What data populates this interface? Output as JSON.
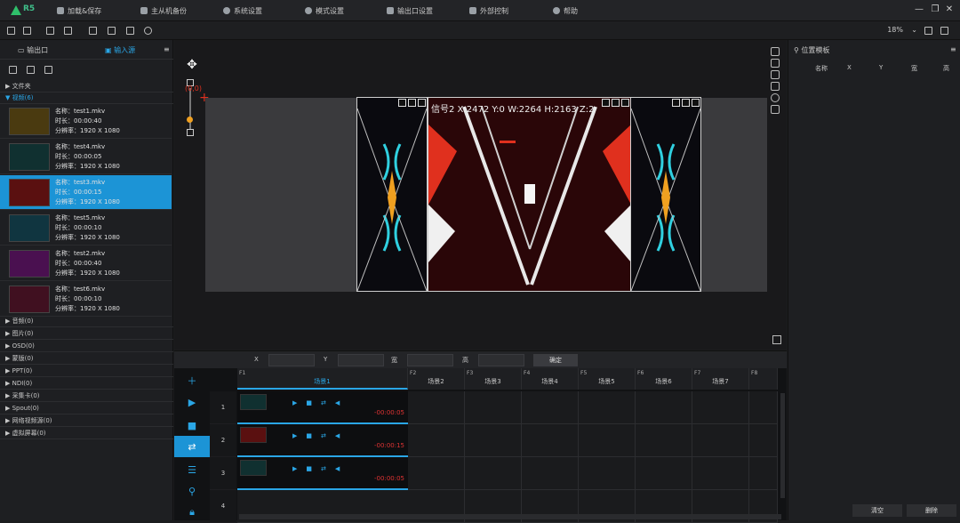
{
  "app": {
    "logo_text": "R5"
  },
  "menu": [
    {
      "label": "加载&保存",
      "icon": "save-icon"
    },
    {
      "label": "主从机备份",
      "icon": "backup-icon"
    },
    {
      "label": "系统设置",
      "icon": "gear-icon"
    },
    {
      "label": "模式设置",
      "icon": "mode-icon"
    },
    {
      "label": "输出口设置",
      "icon": "output-icon"
    },
    {
      "label": "外部控制",
      "icon": "control-icon"
    },
    {
      "label": "帮助",
      "icon": "help-icon"
    }
  ],
  "toolbar": {
    "zoom": "18%"
  },
  "left_panel": {
    "tabs": [
      {
        "label": "输出口",
        "active": false
      },
      {
        "label": "输入源",
        "active": true
      }
    ],
    "categories_top": [
      {
        "label": "文件夹"
      },
      {
        "label": "视频(6)"
      }
    ],
    "media": [
      {
        "name": "名称：test1.mkv",
        "duration": "时长：00:00:40",
        "resolution": "分辨率：1920 X 1080",
        "selected": false,
        "thumb": "#4a3a10"
      },
      {
        "name": "名称：test4.mkv",
        "duration": "时长：00:00:05",
        "resolution": "分辨率：1920 X 1080",
        "selected": false,
        "thumb": "#103030"
      },
      {
        "name": "名称：test3.mkv",
        "duration": "时长：00:00:15",
        "resolution": "分辨率：1920 X 1080",
        "selected": true,
        "thumb": "#5a1010"
      },
      {
        "name": "名称：test5.mkv",
        "duration": "时长：00:00:10",
        "resolution": "分辨率：1920 X 1080",
        "selected": false,
        "thumb": "#103540"
      },
      {
        "name": "名称：test2.mkv",
        "duration": "时长：00:00:40",
        "resolution": "分辨率：1920 X 1080",
        "selected": false,
        "thumb": "#4a1050"
      },
      {
        "name": "名称：test6.mkv",
        "duration": "时长：00:00:10",
        "resolution": "分辨率：1920 X 1080",
        "selected": false,
        "thumb": "#401020"
      }
    ],
    "categories": [
      {
        "label": "音频(0)"
      },
      {
        "label": "图片(0)"
      },
      {
        "label": "OSD(0)"
      },
      {
        "label": "蒙版(0)"
      },
      {
        "label": "PPT(0)"
      },
      {
        "label": "NDI(0)"
      },
      {
        "label": "采集卡(0)"
      },
      {
        "label": "Spout(0)"
      },
      {
        "label": "网络视频源(0)"
      },
      {
        "label": "虚拟屏幕(0)"
      }
    ]
  },
  "preview": {
    "origin_label": "(0,0)",
    "signal_status": "信号2  X:2472  Y:0  W:2264  H:2163  Z:2"
  },
  "position_row": {
    "x_label": "X",
    "y_label": "Y",
    "w_label": "宽",
    "h_label": "高",
    "confirm": "确定"
  },
  "timeline": {
    "scenes": [
      {
        "key": "F1",
        "name": "场景1",
        "active": true
      },
      {
        "key": "F2",
        "name": "场景2",
        "active": false
      },
      {
        "key": "F3",
        "name": "场景3",
        "active": false
      },
      {
        "key": "F4",
        "name": "场景4",
        "active": false
      },
      {
        "key": "F5",
        "name": "场景5",
        "active": false
      },
      {
        "key": "F6",
        "name": "场景6",
        "active": false
      },
      {
        "key": "F7",
        "name": "场景7",
        "active": false
      },
      {
        "key": "F8",
        "name": "",
        "active": false
      }
    ],
    "rows": [
      "1",
      "2",
      "3",
      "4"
    ],
    "clips": [
      {
        "time": "-00:00:05",
        "thumb": "#103030"
      },
      {
        "time": "-00:00:15",
        "thumb": "#5a1010"
      },
      {
        "time": "-00:00:05",
        "thumb": "#103030"
      }
    ]
  },
  "right_panel": {
    "title": "位置模板",
    "columns": [
      "名称",
      "X",
      "Y",
      "宽",
      "高"
    ],
    "clear": "清空",
    "delete": "删除"
  },
  "colors": {
    "accent": "#1c94d6",
    "red": "#e0301e"
  }
}
